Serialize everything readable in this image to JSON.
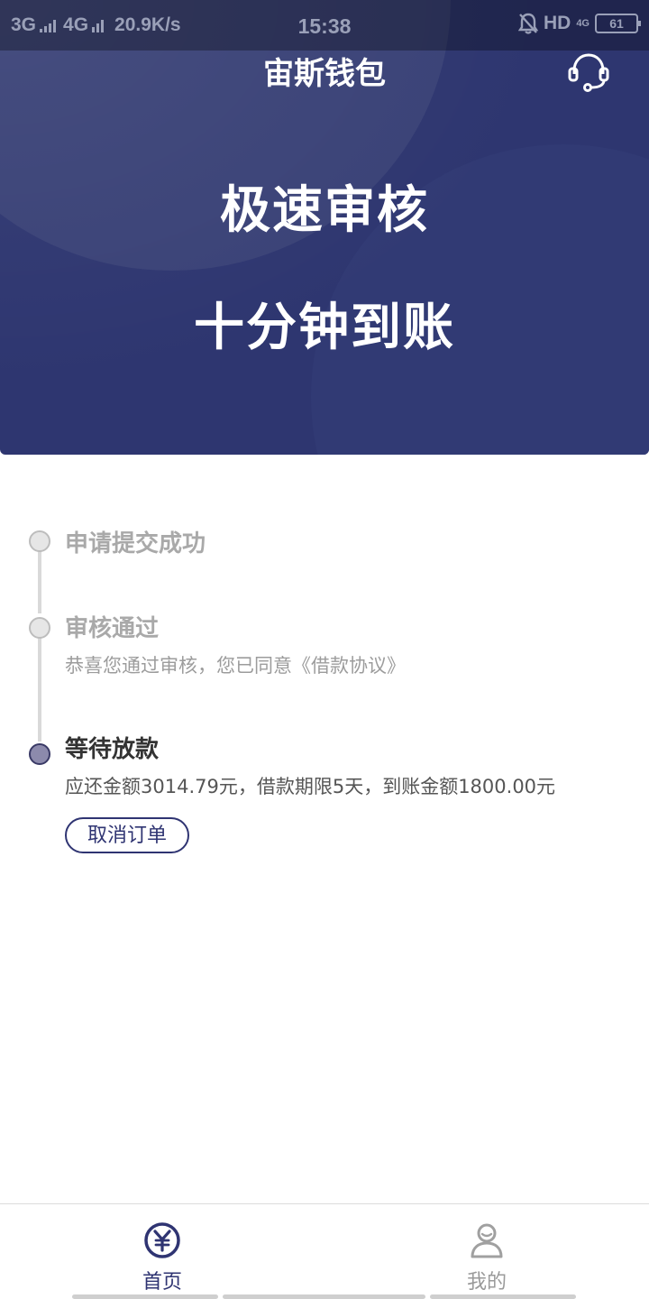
{
  "status_bar": {
    "network_1": "3G",
    "network_2": "4G",
    "speed": "20.9K/s",
    "time": "15:38",
    "hd": "HD",
    "network_3": "4G",
    "battery": "61"
  },
  "header": {
    "title": "宙斯钱包",
    "service_icon": "headset-icon"
  },
  "hero": {
    "slogan_1": "极速审核",
    "slogan_2": "十分钟到账",
    "background_color": "#2e3670"
  },
  "timeline": {
    "steps": [
      {
        "title": "申请提交成功",
        "description": "",
        "active": false
      },
      {
        "title": "审核通过",
        "description": "恭喜您通过审核，您已同意《借款协议》",
        "active": false
      },
      {
        "title": "等待放款",
        "description": "应还金额3014.79元，借款期限5天，到账金额1800.00元",
        "active": true
      }
    ],
    "cancel_label": "取消订单"
  },
  "bottom_nav": {
    "items": [
      {
        "label": "首页",
        "icon": "yuan-coin-icon",
        "selected": true
      },
      {
        "label": "我的",
        "icon": "user-icon",
        "selected": false
      }
    ]
  },
  "colors": {
    "accent": "#2f3472",
    "inactive_text": "#a9a9a9"
  }
}
